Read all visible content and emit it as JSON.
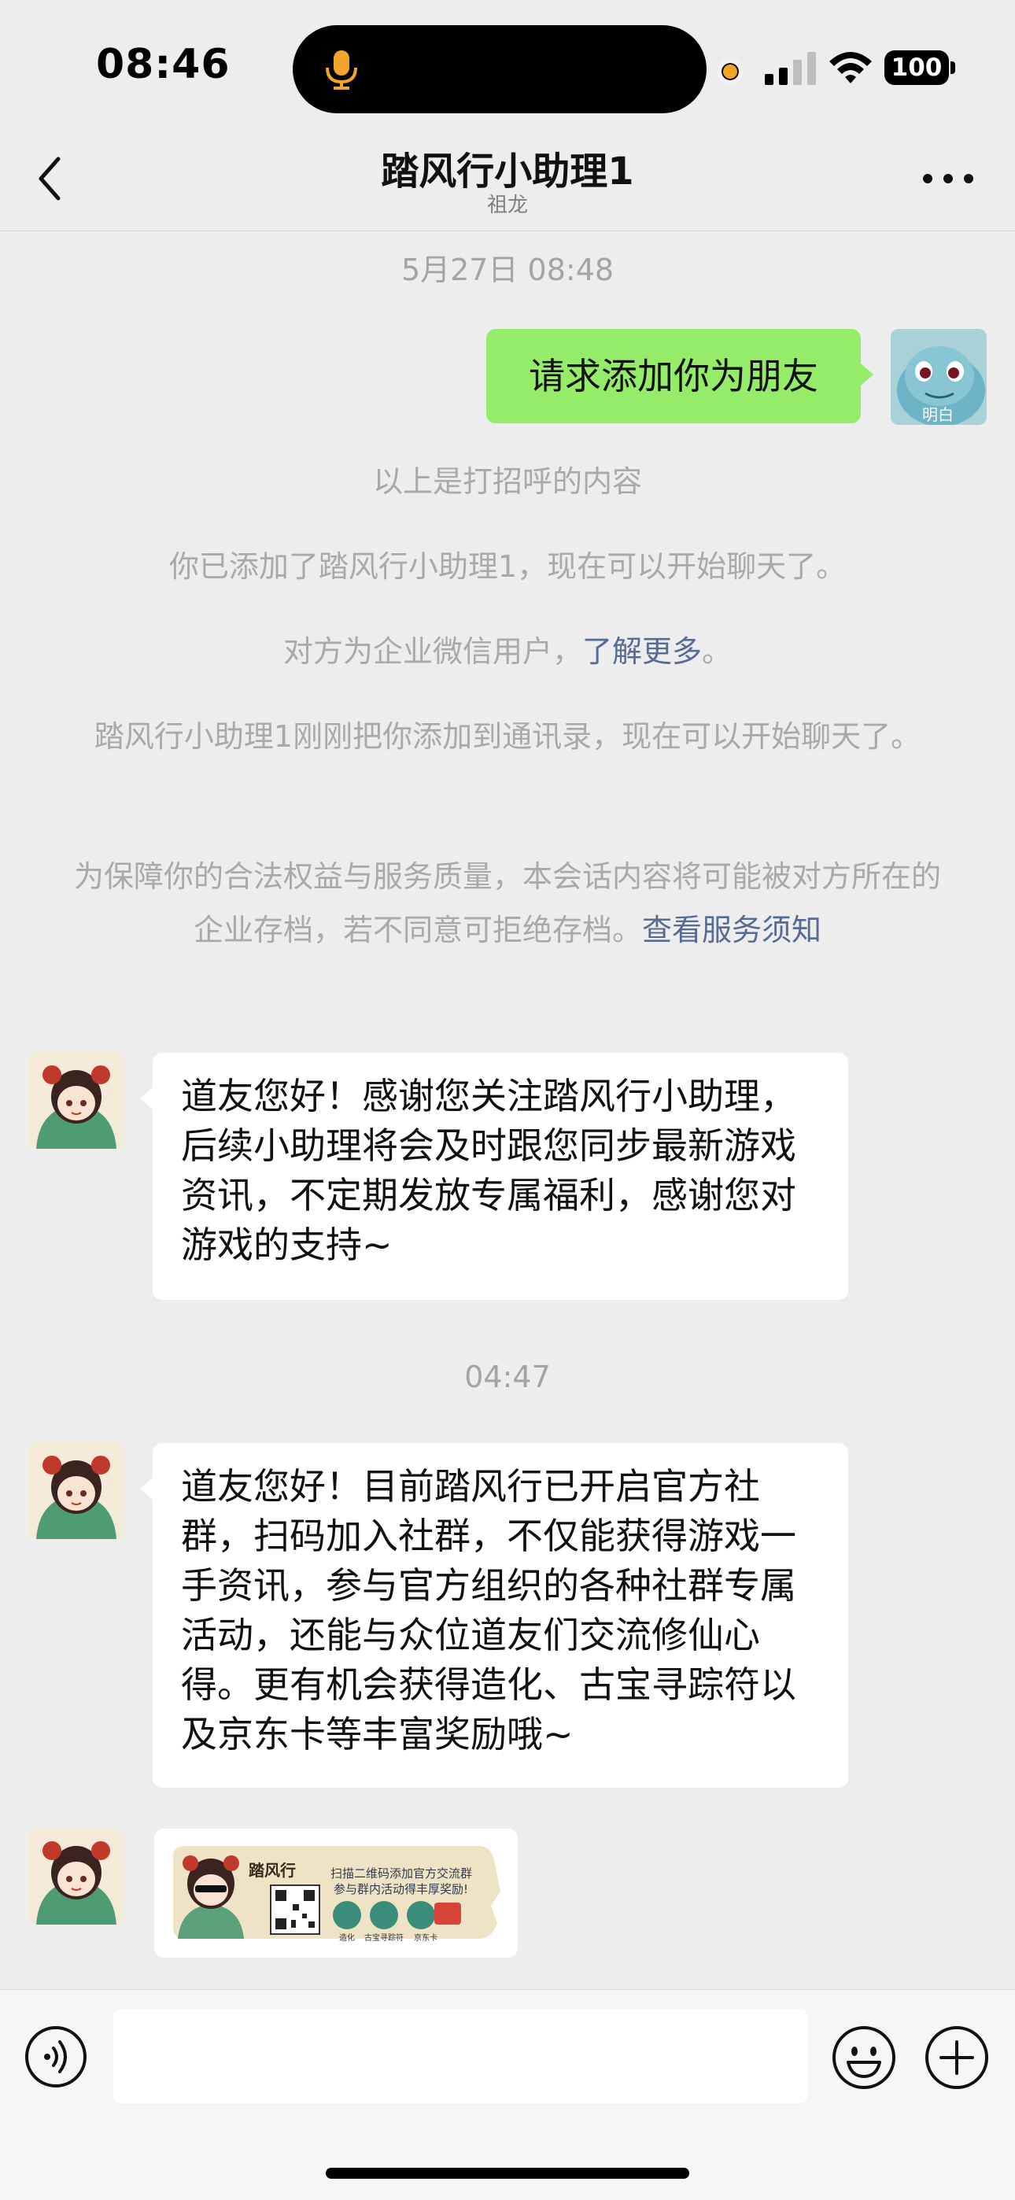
{
  "status_bar": {
    "time": "08:46",
    "battery": "100",
    "icons": [
      "microphone-icon",
      "recording-dot",
      "cellular-signal-icon",
      "wifi-icon",
      "battery-icon"
    ],
    "accent_color": "#f2a52b"
  },
  "nav": {
    "title": "踏风行小助理1",
    "subtitle": "祖龙",
    "back_icon": "chevron-left-icon",
    "more_icon": "more-icon"
  },
  "messages": {
    "timestamp_1": "5月27日 08:48",
    "outgoing_1": "请求添加你为朋友",
    "my_avatar_label": "明白",
    "system_1": "以上是打招呼的内容",
    "system_2": "你已添加了踏风行小助理1，现在可以开始聊天了。",
    "system_3_text": "对方为企业微信用户，",
    "system_3_link": "了解更多",
    "system_3_end": "。",
    "system_4": "踏风行小助理1刚刚把你添加到通讯录，现在可以开始聊天了。",
    "system_5_text": "为保障你的合法权益与服务质量，本会话内容将可能被对方所在的企业存档，若不同意可拒绝存档。",
    "system_5_link": "查看服务须知",
    "incoming_1": "道友您好！感谢您关注踏风行小助理，后续小助理将会及时跟您同步最新游戏资讯，不定期发放专属福利，感谢您对游戏的支持~",
    "timestamp_2": "04:47",
    "incoming_2": "道友您好！目前踏风行已开启官方社群，扫码加入社群，不仅能获得游戏一手资讯，参与官方组织的各种社群专属活动，还能与众位道友们交流修仙心得。更有机会获得造化、古宝寻踪符以及京东卡等丰富奖励哦~",
    "image_card": {
      "logo": "踏风行",
      "line_1": "扫描二维码添加官方交流群",
      "line_2": "参与群内活动得丰厚奖励!",
      "badge_1": "造化",
      "badge_2": "古宝寻踪符",
      "badge_3": "京东卡"
    }
  },
  "input_bar": {
    "voice_icon": "voice-icon",
    "emoji_icon": "emoji-icon",
    "plus_icon": "plus-icon"
  },
  "colors": {
    "background": "#ededed",
    "outgoing_bubble": "#95ec69",
    "incoming_bubble": "#ffffff",
    "link": "#576b95",
    "system_text": "#a9a9a9"
  }
}
